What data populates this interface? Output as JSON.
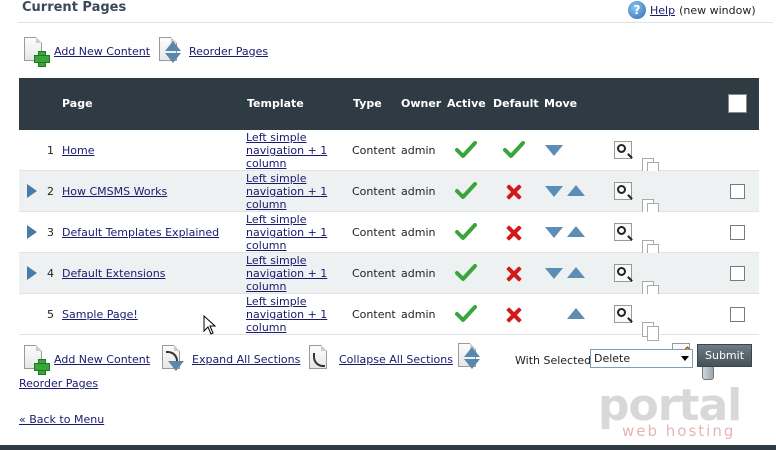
{
  "header": {
    "title": "Current Pages",
    "help_link": "Help",
    "help_suffix": "(new window)"
  },
  "top_actions": {
    "add_new_content": "Add New Content",
    "reorder_pages": "Reorder Pages"
  },
  "table": {
    "columns": {
      "page": "Page",
      "template": "Template",
      "type": "Type",
      "owner": "Owner",
      "active": "Active",
      "default": "Default",
      "move": "Move"
    },
    "rows": [
      {
        "num": "1",
        "page": "Home",
        "template_l1": "Left simple",
        "template_l2": "navigation + 1",
        "template_l3": "column",
        "type": "Content",
        "owner": "admin",
        "active": true,
        "default": true,
        "expandable": false,
        "move": "down",
        "deletable": false,
        "checkbox": false
      },
      {
        "num": "2",
        "page": "How CMSMS Works",
        "template_l1": "Left simple",
        "template_l2": "navigation + 1",
        "template_l3": "column",
        "type": "Content",
        "owner": "admin",
        "active": true,
        "default": false,
        "expandable": true,
        "move": "both",
        "deletable": false,
        "checkbox": true
      },
      {
        "num": "3",
        "page": "Default Templates Explained",
        "template_l1": "Left simple",
        "template_l2": "navigation + 1",
        "template_l3": "column",
        "type": "Content",
        "owner": "admin",
        "active": true,
        "default": false,
        "expandable": true,
        "move": "both",
        "deletable": false,
        "checkbox": true
      },
      {
        "num": "4",
        "page": "Default Extensions",
        "template_l1": "Left simple",
        "template_l2": "navigation + 1",
        "template_l3": "column",
        "type": "Content",
        "owner": "admin",
        "active": true,
        "default": false,
        "expandable": true,
        "move": "both",
        "deletable": false,
        "checkbox": true
      },
      {
        "num": "5",
        "page": "Sample Page!",
        "template_l1": "Left simple",
        "template_l2": "navigation + 1",
        "template_l3": "column",
        "type": "Content",
        "owner": "admin",
        "active": true,
        "default": false,
        "expandable": false,
        "move": "up",
        "deletable": true,
        "checkbox": true
      }
    ]
  },
  "bottom_actions": {
    "add_new_content": "Add New Content",
    "expand_all": "Expand All Sections",
    "collapse_all": "Collapse All Sections",
    "reorder_pages": "Reorder Pages",
    "with_selected_label": "With Selected:",
    "with_selected_value": "Delete",
    "submit": "Submit",
    "back_to_menu": "« Back to Menu"
  },
  "watermark": {
    "brand": "portal",
    "tagline": "web hosting"
  },
  "colors": {
    "header_bg": "#2f3b42",
    "accent": "#5b8db6",
    "active_green": "#3aa53a",
    "inactive_red": "#d21a1a"
  }
}
